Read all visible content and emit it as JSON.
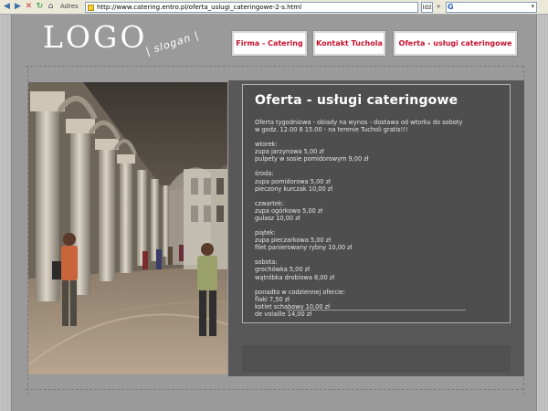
{
  "browser": {
    "address_label": "Adres",
    "url": "http://www.catering.entro.pl/oferta_uslugi_cateringowe-2-s.html",
    "go_label": "Idź",
    "links_label": "»",
    "search_logo": "G",
    "search_arrow": "▾"
  },
  "header": {
    "logo": "LOGO",
    "slogan": "| slogan |",
    "nav": [
      {
        "label": "Firma - Catering"
      },
      {
        "label": "Kontakt Tuchola"
      },
      {
        "label": "Oferta - usługi cateringowe"
      }
    ]
  },
  "content": {
    "title": "Oferta - usługi cateringowe",
    "paragraphs": [
      [
        "Oferta tygodniowa - obiady na wynos - dostawa od wtorku do soboty",
        "w godz. 12.00 8 15.00 - na terenie Tucholi gratis!!!"
      ],
      [
        "wtorek:",
        "zupa jarzynowa 5,00 zł",
        "pulpety w sosie pomidorowym 9,00 zł"
      ],
      [
        "środa:",
        "zupa pomidorowa 5,00 zł",
        "pieczony kurczak 10,00 zł"
      ],
      [
        "czwartek:",
        "zupa ogórkowa 5,00 zł",
        "gulasz 10,00 zł"
      ],
      [
        "piątek:",
        "zupa pieczarkowa 5,00 zł",
        "filet panierowany rybny 10,00 zł"
      ],
      [
        "sobota:",
        "grochówka 5,00 zł",
        "wątróbka drobiowa 8,00 zł"
      ],
      [
        "ponadto w codziennej ofercie:",
        "flaki 7,50 zł",
        "kotlet schabowy 10,00 zł",
        "de volaille 14,00 zł"
      ]
    ]
  },
  "colors": {
    "nav_text": "#c8102e",
    "content_bg": "#4e4e4e",
    "page_bg": "#9a9a9a"
  }
}
